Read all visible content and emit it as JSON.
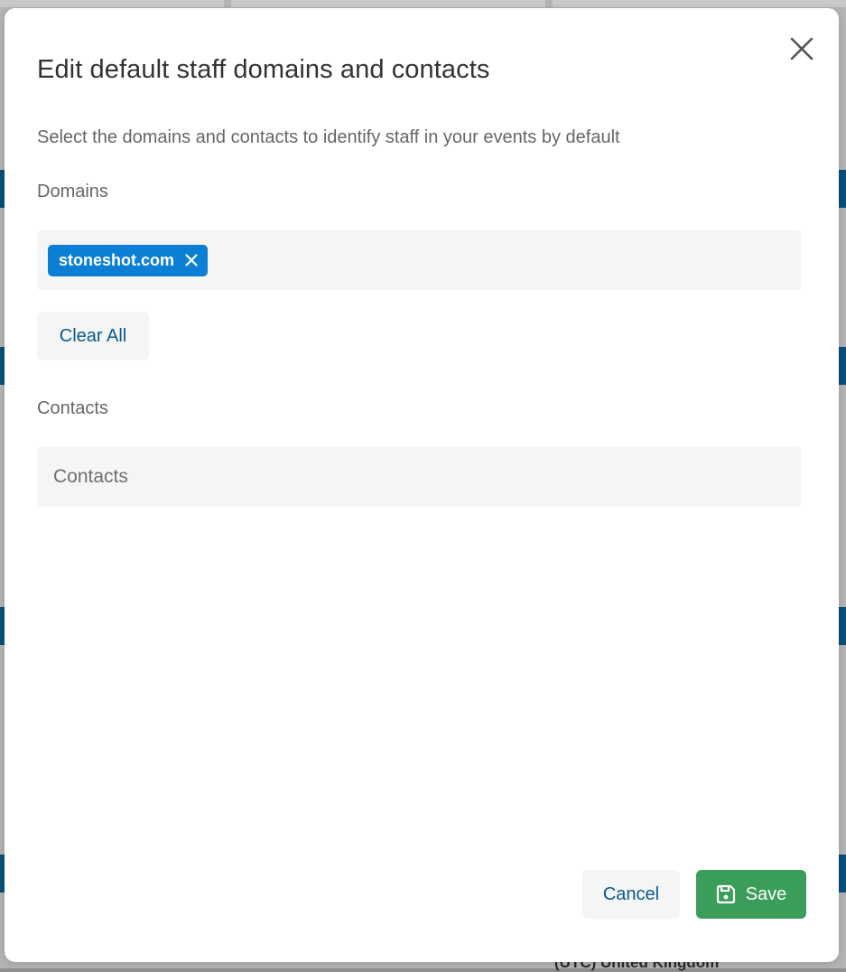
{
  "background": {
    "footer_text": "(UTC) United Kingdom"
  },
  "modal": {
    "title": "Edit default staff domains and contacts",
    "subtitle": "Select the domains and contacts to identify staff in your events by default",
    "close_icon": "close-icon"
  },
  "domains": {
    "label": "Domains",
    "chips": [
      {
        "label": "stoneshot.com",
        "remove_icon": "close-icon"
      }
    ],
    "clear_all_label": "Clear All"
  },
  "contacts": {
    "label": "Contacts",
    "placeholder": "Contacts",
    "value": ""
  },
  "footer": {
    "cancel_label": "Cancel",
    "save_label": "Save",
    "save_icon": "floppy-disk-icon"
  },
  "colors": {
    "chip_bg": "#0a7fd4",
    "save_bg": "#3a9d5a",
    "link_text": "#0a5a8c",
    "field_bg": "#f4f5f5"
  }
}
